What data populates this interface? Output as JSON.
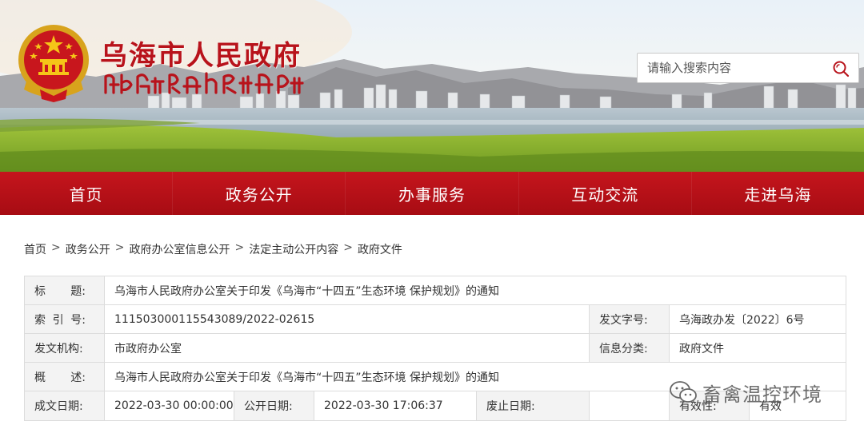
{
  "header": {
    "site_title": "乌海市人民政府",
    "site_title_mongolian": "ᠤᠤᠬᠠᠢ ᠬᠣᠲᠠ ᠶᠢᠨ ᠠᠷᠠᠳ ᠤᠨ ᠵᠠᠰᠠᠭ ᠤᠨ ᠭᠠᠵᠠᠷ",
    "emblem_icon": "national-emblem-icon",
    "search": {
      "placeholder": "请输入搜索内容",
      "icon": "search-icon"
    },
    "colors": {
      "brand_red": "#b8131b",
      "nav_red": "#b5111a"
    }
  },
  "nav": {
    "items": [
      {
        "label": "首页"
      },
      {
        "label": "政务公开"
      },
      {
        "label": "办事服务"
      },
      {
        "label": "互动交流"
      },
      {
        "label": "走进乌海"
      }
    ]
  },
  "breadcrumb": {
    "items": [
      "首页",
      "政务公开",
      "政府办公室信息公开",
      "法定主动公开内容",
      "政府文件"
    ],
    "separator": ">"
  },
  "info": {
    "title_label": [
      "标",
      "题:"
    ],
    "title_value": "乌海市人民政府办公室关于印发《乌海市“十四五”生态环境 保护规划》的通知",
    "index_label": [
      "索",
      "引",
      "号:"
    ],
    "index_value": "111503000115543089/2022-02615",
    "doc_no_label": "发文字号:",
    "doc_no_value": "乌海政办发〔2022〕6号",
    "issuer_label": "发文机构:",
    "issuer_value": "市政府办公室",
    "category_label": "信息分类:",
    "category_value": "政府文件",
    "summary_label": [
      "概",
      "述:"
    ],
    "summary_value": "乌海市人民政府办公室关于印发《乌海市“十四五”生态环境 保护规划》的通知",
    "created_label": "成文日期:",
    "created_value": "2022-03-30 00:00:00",
    "published_label": "公开日期:",
    "published_value": "2022-03-30 17:06:37",
    "repealed_label": "废止日期:",
    "repealed_value": "",
    "validity_label": "有效性:",
    "validity_value": "有效"
  },
  "watermark": {
    "text": "畜禽温控环境",
    "icon": "wechat-icon"
  }
}
